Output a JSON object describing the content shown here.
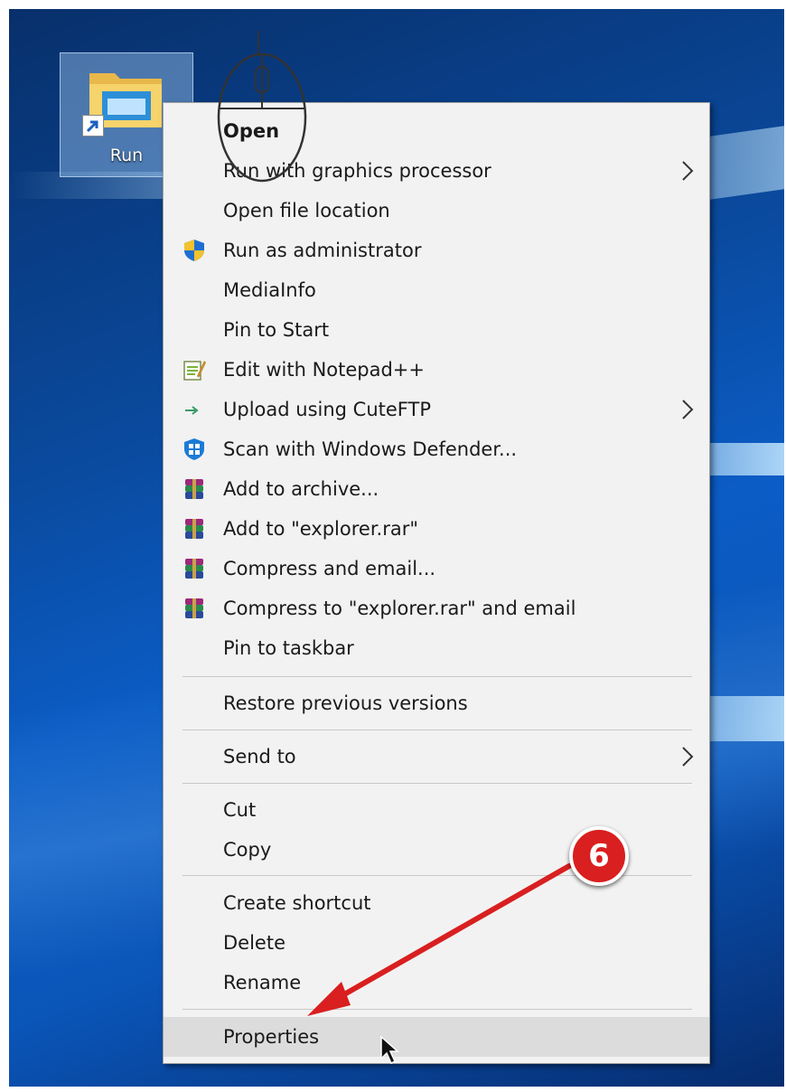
{
  "desktop": {
    "icon_label": "Run"
  },
  "menu": {
    "items": [
      {
        "label": "Open",
        "icon": "",
        "submenu": false
      },
      {
        "label": "Run with graphics processor",
        "icon": "",
        "submenu": true
      },
      {
        "label": "Open file location",
        "icon": "",
        "submenu": false
      },
      {
        "label": "Run as administrator",
        "icon": "uac-shield-icon",
        "submenu": false
      },
      {
        "label": "MediaInfo",
        "icon": "",
        "submenu": false
      },
      {
        "label": "Pin to Start",
        "icon": "",
        "submenu": false
      },
      {
        "label": "Edit with Notepad++",
        "icon": "notepad-plus-plus-icon",
        "submenu": false
      },
      {
        "label": "Upload using CuteFTP",
        "icon": "cuteftp-icon",
        "submenu": true
      },
      {
        "label": "Scan with Windows Defender...",
        "icon": "windows-defender-icon",
        "submenu": false
      },
      {
        "label": "Add to archive...",
        "icon": "winrar-icon",
        "submenu": false
      },
      {
        "label": "Add to \"explorer.rar\"",
        "icon": "winrar-icon",
        "submenu": false
      },
      {
        "label": "Compress and email...",
        "icon": "winrar-icon",
        "submenu": false
      },
      {
        "label": "Compress to \"explorer.rar\" and email",
        "icon": "winrar-icon",
        "submenu": false
      },
      {
        "label": "Pin to taskbar",
        "icon": "",
        "submenu": false
      },
      {
        "label": "Restore previous versions",
        "icon": "",
        "submenu": false
      },
      {
        "label": "Send to",
        "icon": "",
        "submenu": true
      },
      {
        "label": "Cut",
        "icon": "",
        "submenu": false
      },
      {
        "label": "Copy",
        "icon": "",
        "submenu": false
      },
      {
        "label": "Create shortcut",
        "icon": "",
        "submenu": false
      },
      {
        "label": "Delete",
        "icon": "",
        "submenu": false
      },
      {
        "label": "Rename",
        "icon": "",
        "submenu": false
      },
      {
        "label": "Properties",
        "icon": "",
        "submenu": false,
        "highlighted": true
      }
    ]
  },
  "annotation": {
    "step_number": "6"
  },
  "colors": {
    "menu_bg": "#f2f2f2",
    "highlight": "#dcdcdc",
    "annotation_red": "#d91f1f"
  }
}
